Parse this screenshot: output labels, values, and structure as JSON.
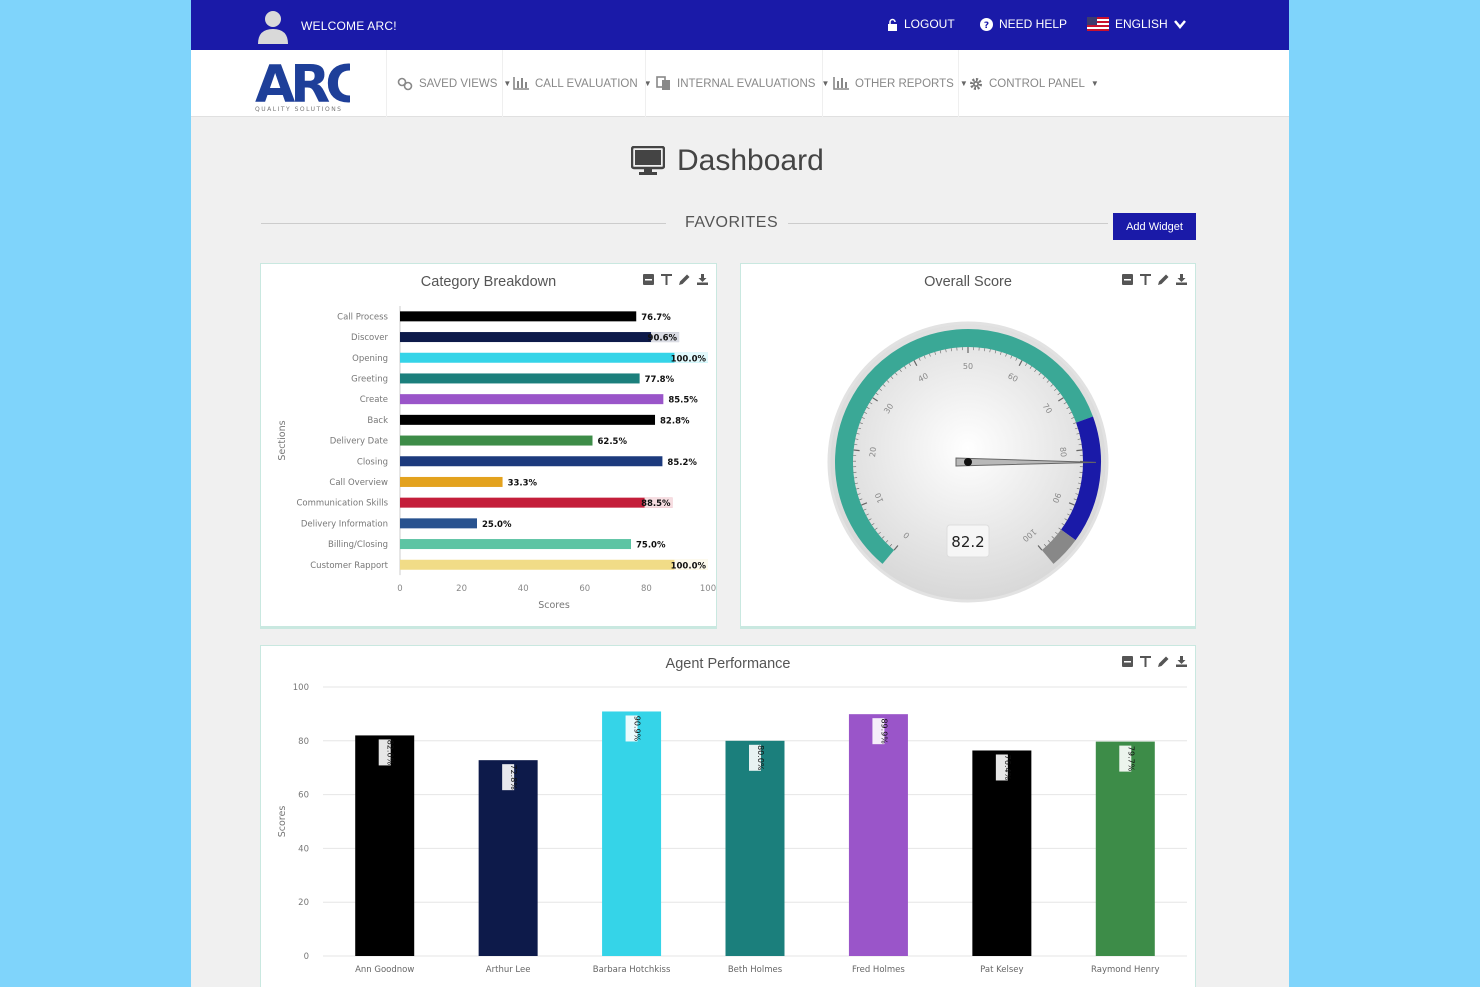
{
  "topbar": {
    "welcome": "WELCOME ARC!",
    "logout": "LOGOUT",
    "help": "NEED HELP",
    "language": "ENGLISH"
  },
  "logo": {
    "text": "ARC",
    "tagline": "QUALITY SOLUTIONS"
  },
  "nav": {
    "items": [
      {
        "label": "SAVED VIEWS",
        "icon": "link-icon"
      },
      {
        "label": "CALL EVALUATION",
        "icon": "bar-chart-icon"
      },
      {
        "label": "INTERNAL EVALUATIONS",
        "icon": "copy-icon"
      },
      {
        "label": "OTHER REPORTS",
        "icon": "bar-chart-icon"
      },
      {
        "label": "CONTROL PANEL",
        "icon": "gear-icon"
      }
    ]
  },
  "page": {
    "title": "Dashboard",
    "section": "FAVORITES",
    "add_widget": "Add Widget"
  },
  "colors": {
    "primary": "#1a1aa8",
    "teal": "#3aa896"
  },
  "widgets": {
    "category": "Category Breakdown",
    "gauge": "Overall Score",
    "agent": "Agent Performance"
  },
  "chart_data": [
    {
      "type": "bar",
      "orientation": "horizontal",
      "title": "Category Breakdown",
      "xlabel": "Scores",
      "ylabel": "Sections",
      "xlim": [
        0,
        100
      ],
      "xticks": [
        "0",
        "20",
        "40",
        "60",
        "80",
        "100"
      ],
      "categories": [
        "Call Process",
        "Discover",
        "Opening",
        "Greeting",
        "Create",
        "Back",
        "Delivery Date",
        "Closing",
        "Call Overview",
        "Communication Skills",
        "Delivery Information",
        "Billing/Closing",
        "Customer Rapport"
      ],
      "values": [
        76.7,
        90.6,
        100.0,
        77.8,
        85.5,
        82.8,
        62.5,
        85.2,
        33.3,
        88.5,
        25.0,
        75.0,
        100.0
      ],
      "labels": [
        "76.7%",
        "90.6%",
        "100.0%",
        "77.8%",
        "85.5%",
        "82.8%",
        "62.5%",
        "85.2%",
        "33.3%",
        "88.5%",
        "25.0%",
        "75.0%",
        "100.0%"
      ],
      "colors": [
        "#000000",
        "#0d1a4a",
        "#35d4e8",
        "#1b7f7c",
        "#9a55c9",
        "#000000",
        "#3d8c48",
        "#1c3a7d",
        "#e3a21e",
        "#c41e3a",
        "#28528f",
        "#5cc4a3",
        "#f1dc87"
      ],
      "grid": false
    },
    {
      "type": "gauge",
      "title": "Overall Score",
      "value": 82.2,
      "value_label": "82.2",
      "min": 0,
      "max": 100,
      "ticks": [
        "0",
        "10",
        "20",
        "30",
        "40",
        "50",
        "60",
        "70",
        "80",
        "90",
        "100"
      ],
      "bands": [
        {
          "from": 0,
          "to": 75,
          "color": "#3aa896"
        },
        {
          "from": 75,
          "to": 95,
          "color": "#1a1aa8"
        },
        {
          "from": 95,
          "to": 100,
          "color": "#888888"
        }
      ]
    },
    {
      "type": "bar",
      "title": "Agent Performance",
      "ylabel": "Scores",
      "ylim": [
        0,
        100
      ],
      "yticks": [
        "0",
        "20",
        "40",
        "60",
        "80",
        "100"
      ],
      "categories": [
        "Ann Goodnow",
        "Arthur Lee",
        "Barbara Hotchkiss",
        "Beth Holmes",
        "Fred Holmes",
        "Pat Kelsey",
        "Raymond Henry"
      ],
      "values": [
        82.0,
        72.8,
        90.9,
        80.0,
        89.9,
        76.4,
        79.7
      ],
      "labels": [
        "82.0%",
        "72.8%",
        "90.9%",
        "80.0%",
        "89.9%",
        "76.4%",
        "79.7%"
      ],
      "colors": [
        "#000000",
        "#0d1a4a",
        "#35d4e8",
        "#1b7f7c",
        "#9a55c9",
        "#000000",
        "#3d8c48"
      ],
      "grid": true
    }
  ]
}
